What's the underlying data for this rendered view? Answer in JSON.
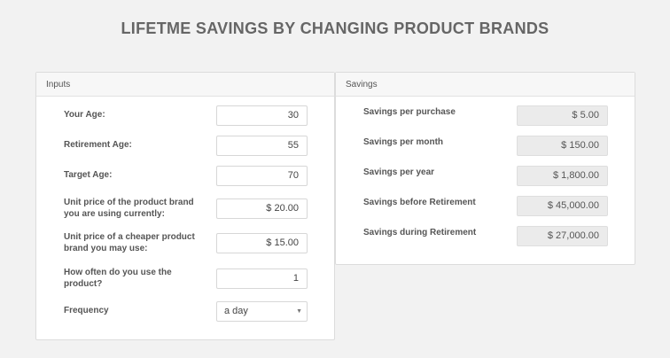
{
  "page": {
    "title": "LIFETME SAVINGS BY CHANGING PRODUCT BRANDS"
  },
  "inputs": {
    "header": "Inputs",
    "your_age": {
      "label": "Your Age:",
      "value": "30"
    },
    "retirement_age": {
      "label": "Retirement Age:",
      "value": "55"
    },
    "target_age": {
      "label": "Target Age:",
      "value": "70"
    },
    "unit_price_current": {
      "label_line1": "Unit price of the product brand",
      "label_line2": "you are using currently:",
      "value": "$ 20.00"
    },
    "unit_price_cheaper": {
      "label_line1": "Unit price of a cheaper product",
      "label_line2": "brand you may use:",
      "value": "$ 15.00"
    },
    "how_often": {
      "label_line1": "How often do you use the",
      "label_line2": "product?",
      "value": "1"
    },
    "frequency": {
      "label": "Frequency",
      "selected": "a day"
    }
  },
  "savings": {
    "header": "Savings",
    "per_purchase": {
      "label": "Savings per purchase",
      "value": "$ 5.00"
    },
    "per_month": {
      "label": "Savings per month",
      "value": "$ 150.00"
    },
    "per_year": {
      "label": "Savings per year",
      "value": "$ 1,800.00"
    },
    "before_retirement": {
      "label": "Savings before Retirement",
      "value": "$ 45,000.00"
    },
    "during_retirement": {
      "label": "Savings during Retirement",
      "value": "$ 27,000.00"
    }
  }
}
